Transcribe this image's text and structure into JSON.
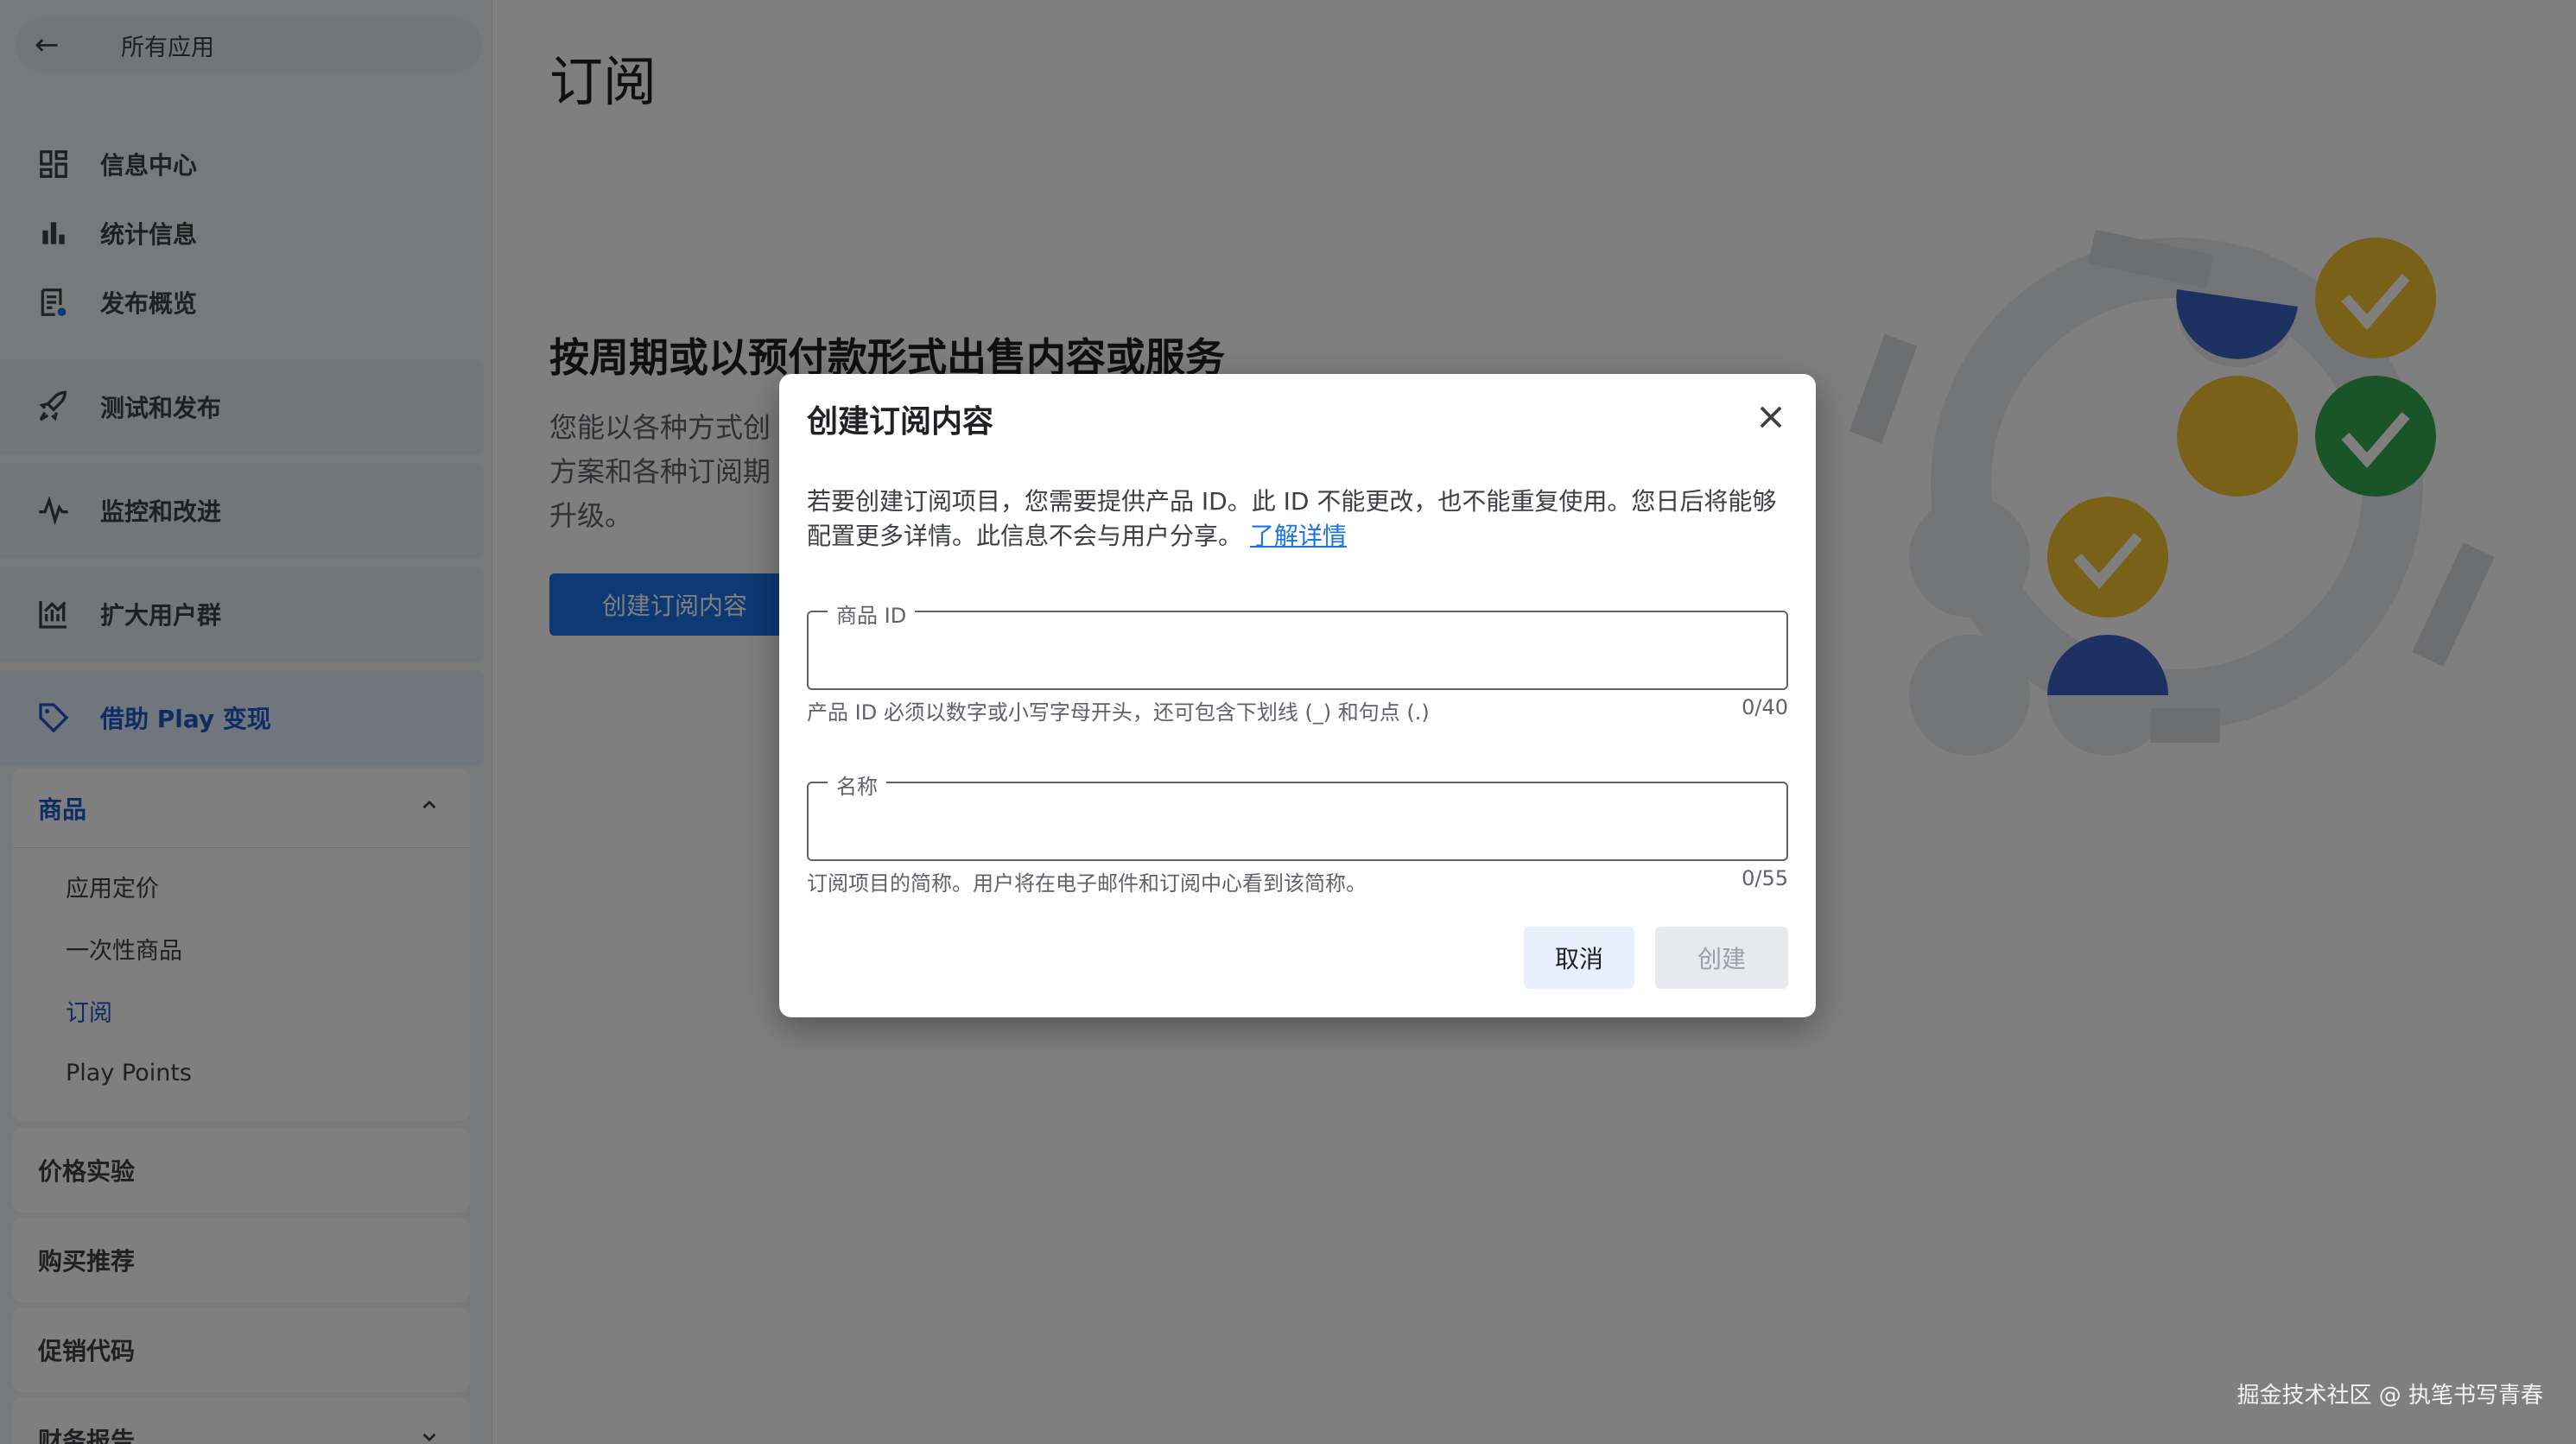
{
  "sidebar": {
    "back_label": "所有应用",
    "top_items": [
      {
        "label": "信息中心",
        "icon": "dashboard-icon"
      },
      {
        "label": "统计信息",
        "icon": "bar-chart-icon"
      },
      {
        "label": "发布概览",
        "icon": "release-overview-icon"
      }
    ],
    "groups": [
      {
        "label": "测试和发布",
        "icon": "rocket-icon"
      },
      {
        "label": "监控和改进",
        "icon": "pulse-icon"
      },
      {
        "label": "扩大用户群",
        "icon": "growth-icon"
      },
      {
        "label": "借助 Play 变现",
        "icon": "tag-icon"
      }
    ],
    "products_section": {
      "label": "商品",
      "items": [
        "应用定价",
        "一次性商品",
        "订阅",
        "Play Points"
      ],
      "selected": "订阅"
    },
    "more_sections": [
      "价格实验",
      "购买推荐",
      "促销代码",
      "财务报告"
    ]
  },
  "main": {
    "title": "订阅",
    "heading": "按周期或以预付款形式出售内容或服务",
    "body": "您能以各种方式创 方案和各种订阅期 升级。",
    "body_lines": [
      "您能以各种方式创",
      "方案和各种订阅期",
      "升级。"
    ],
    "create_button": "创建订阅内容"
  },
  "dialog": {
    "title": "创建订阅内容",
    "desc_line1": "若要创建订阅项目，您需要提供产品 ID。此 ID 不能更改，也不能重复使用。您日后将能够",
    "desc_line2": "配置更多详情。此信息不会与用户分享。",
    "learn_more": "了解详情",
    "product_id_label": "商品 ID",
    "product_id_value": "",
    "product_id_helper": "产品 ID 必须以数字或小写字母开头，还可包含下划线 (_) 和句点 (.)",
    "product_id_count": "0/40",
    "name_label": "名称",
    "name_value": "",
    "name_helper": "订阅项目的简称。用户将在电子邮件和订阅中心看到该简称。",
    "name_count": "0/55",
    "cancel_label": "取消",
    "create_label": "创建"
  },
  "watermark": "掘金技术社区 @ 执笔书写青春",
  "colors": {
    "accent": "#1a73e8",
    "illus_blue": "#3b64c4",
    "illus_yellow": "#f2c230",
    "illus_green": "#34a853"
  }
}
